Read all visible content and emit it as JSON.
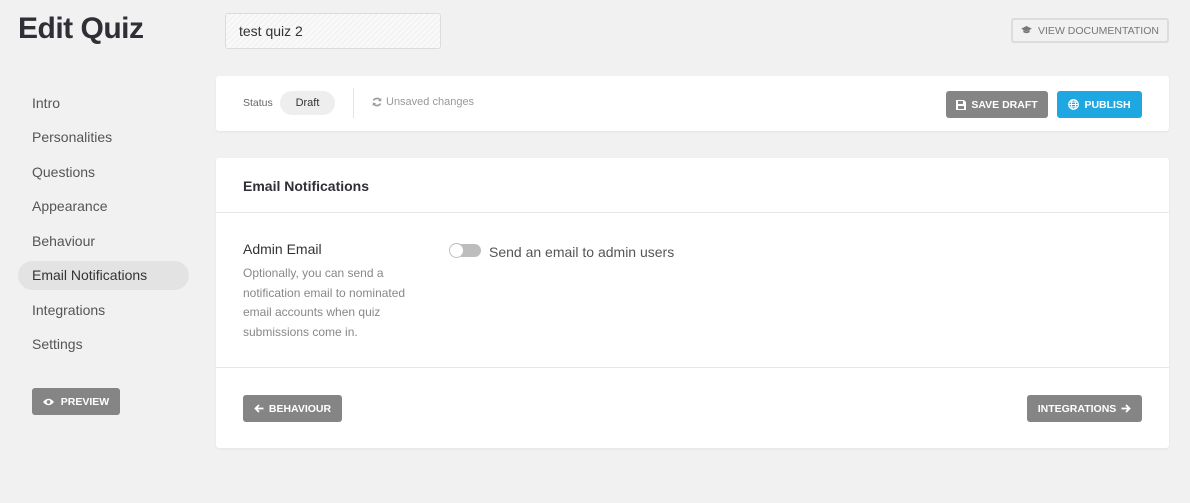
{
  "header": {
    "title": "Edit Quiz",
    "quiz_name_value": "test quiz 2",
    "docs_button": {
      "label": "VIEW DOCUMENTATION",
      "icon": "graduation-cap-icon"
    }
  },
  "sidebar": {
    "items": [
      {
        "label": "Intro",
        "active": false
      },
      {
        "label": "Personalities",
        "active": false
      },
      {
        "label": "Questions",
        "active": false
      },
      {
        "label": "Appearance",
        "active": false
      },
      {
        "label": "Behaviour",
        "active": false
      },
      {
        "label": "Email Notifications",
        "active": true
      },
      {
        "label": "Integrations",
        "active": false
      },
      {
        "label": "Settings",
        "active": false
      }
    ],
    "preview_button": {
      "label": "PREVIEW",
      "icon": "eye-icon"
    }
  },
  "status_bar": {
    "status_label": "Status",
    "status_value": "Draft",
    "unsaved_text": "Unsaved changes",
    "unsaved_icon": "refresh-icon",
    "save_draft": {
      "label": "SAVE DRAFT",
      "icon": "floppy-disk-icon"
    },
    "publish": {
      "label": "PUBLISH",
      "icon": "globe-icon"
    },
    "colors": {
      "publish": "#1fa7e1",
      "secondary": "#858585"
    }
  },
  "section": {
    "title": "Email Notifications",
    "admin_email": {
      "label": "Admin Email",
      "help": "Optionally, you can send a notification email to nominated email accounts when quiz submissions come in.",
      "toggle_label": "Send an email to admin users",
      "toggle_on": false
    },
    "nav": {
      "back": {
        "label": "BEHAVIOUR",
        "icon": "arrow-left-icon"
      },
      "next": {
        "label": "INTEGRATIONS",
        "icon": "arrow-right-icon"
      }
    }
  }
}
